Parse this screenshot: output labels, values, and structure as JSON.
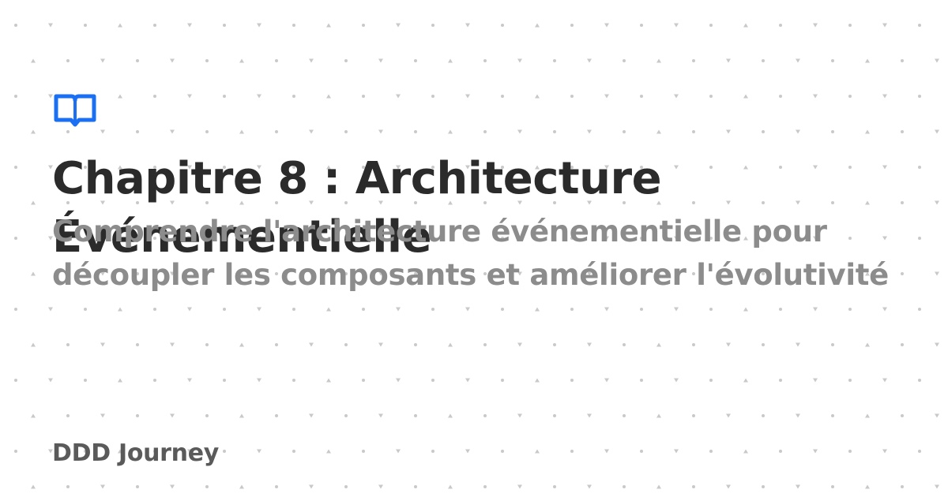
{
  "card": {
    "title": "Chapitre 8 : Architecture Événementielle",
    "subtitle": "Comprendre l'architecture événementielle pour découpler les composants et améliorer l'évolutivité",
    "brand": "DDD Journey"
  },
  "icons": {
    "logo": "open-book-icon",
    "pattern": "dot-triangle-pattern-icon"
  },
  "colors": {
    "background": "#ffffff",
    "accent": "#1a6ff3",
    "title": "#2b2b2b",
    "subtitle": "#8c8c8c",
    "brand": "#5a5a5a",
    "pattern": "#c9c9c9"
  }
}
